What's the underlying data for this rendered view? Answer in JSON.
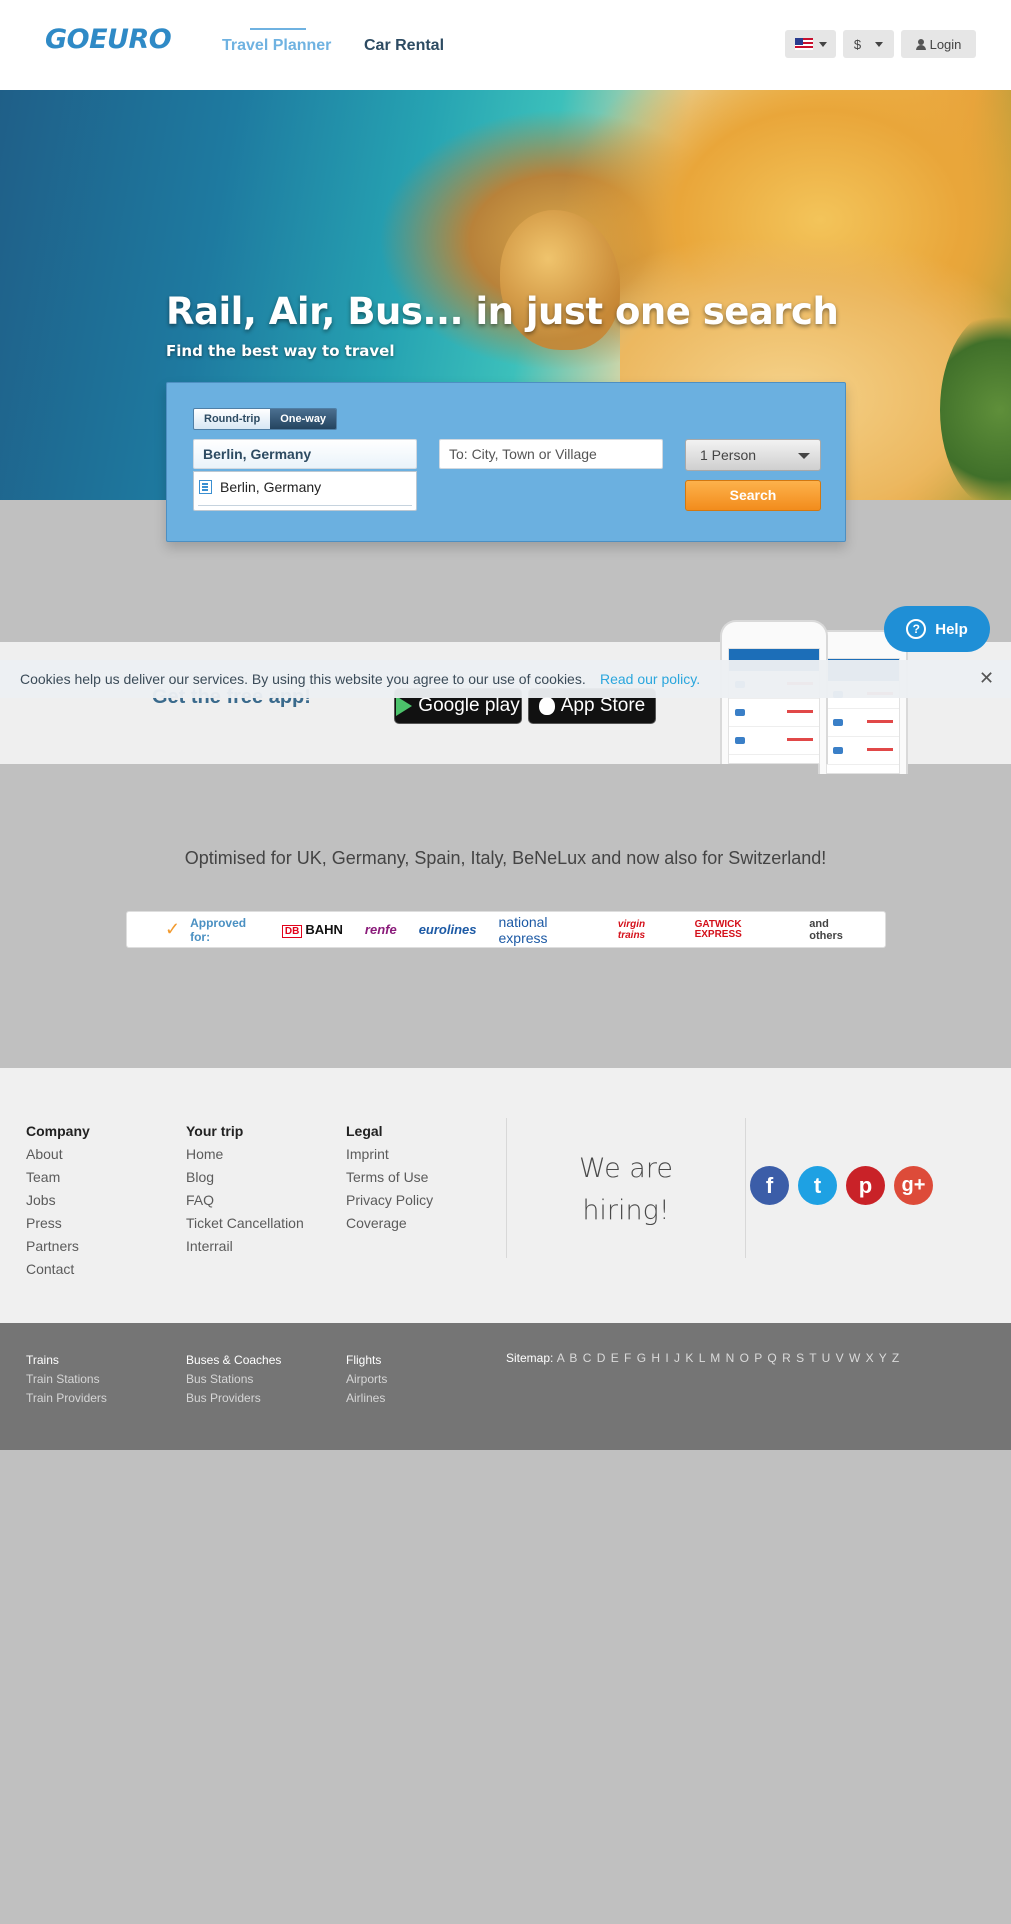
{
  "header": {
    "logo": "GOEURO",
    "nav": [
      "Travel Planner",
      "Car Rental"
    ],
    "currency": "$",
    "login": "Login"
  },
  "hero": {
    "title": "Rail, Air, Bus... in just one search",
    "subtitle": "Find the best way to travel"
  },
  "search": {
    "round_trip": "Round-trip",
    "one_way": "One-way",
    "from_value": "Berlin, Germany",
    "to_placeholder": "To: City, Town or Village",
    "suggestion": "Berlin, Germany",
    "passengers": "1 Person",
    "search_button": "Search"
  },
  "app": {
    "text": "Get the free app!",
    "google_play": "Google play",
    "app_store": "App Store"
  },
  "cookie": {
    "text": "Cookies help us deliver our services. By using this website you agree to our use of cookies.",
    "link": "Read our policy.",
    "close": "✕"
  },
  "help": {
    "icon": "?",
    "label": "Help"
  },
  "optimised": "Optimised for UK, Germany, Spain, Italy, BeNeLux and now also for Switzerland!",
  "approved": {
    "label": "Approved for:",
    "providers": [
      "DB",
      "BAHN",
      "renfe",
      "eurolines",
      "national express",
      "virgin trains",
      "GATWICK EXPRESS",
      "and others"
    ]
  },
  "footer": {
    "company": {
      "title": "Company",
      "items": [
        "About",
        "Team",
        "Jobs",
        "Press",
        "Partners",
        "Contact"
      ]
    },
    "your_trip": {
      "title": "Your trip",
      "items": [
        "Home",
        "Blog",
        "FAQ",
        "Ticket Cancellation",
        "Interrail"
      ]
    },
    "legal": {
      "title": "Legal",
      "items": [
        "Imprint",
        "Terms of Use",
        "Privacy Policy",
        "Coverage"
      ]
    },
    "hiring": [
      "We are",
      "hiring!"
    ],
    "social": [
      "f",
      "t",
      "p",
      "g+"
    ]
  },
  "subfooter": {
    "trains": {
      "title": "Trains",
      "items": [
        "Train Stations",
        "Train Providers"
      ]
    },
    "buses": {
      "title": "Buses & Coaches",
      "items": [
        "Bus Stations",
        "Bus Providers"
      ]
    },
    "flights": {
      "title": "Flights",
      "items": [
        "Airports",
        "Airlines"
      ]
    },
    "sitemap_label": "Sitemap:",
    "sitemap_letters": "A B C D E F G H I J K L M N O P Q R S T U V W X Y Z"
  },
  "colors": {
    "brand": "#2f8ac6",
    "search_panel": "#6bb0e0",
    "search_button": "#f28c1c",
    "help": "#1f8fd6",
    "link": "#2aa6dd"
  }
}
